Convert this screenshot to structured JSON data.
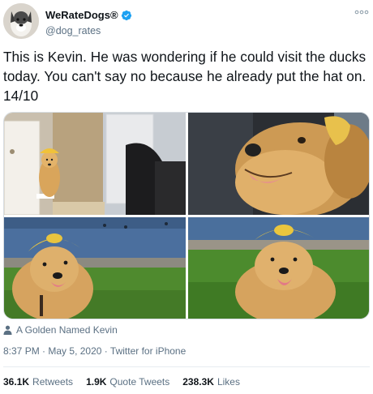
{
  "author": {
    "display_name": "WeRateDogs®",
    "handle": "@dog_rates"
  },
  "tweet": {
    "text": "This is Kevin. He was wondering if he could visit the ducks today. You can't say no because he already put the hat on. 14/10",
    "tagged_user": "A Golden Named Kevin",
    "time": "8:37 PM",
    "separator": "·",
    "date": "May 5, 2020",
    "source": "Twitter for iPhone"
  },
  "stats": {
    "retweets_count": "36.1K",
    "retweets_label": "Retweets",
    "quote_count": "1.9K",
    "quote_label": "Quote Tweets",
    "likes_count": "238.3K",
    "likes_label": "Likes"
  },
  "icons": {
    "verified": "verified-badge-icon",
    "more": "more-options-icon",
    "tag": "person-icon"
  },
  "colors": {
    "verified_blue": "#1da1f2",
    "secondary_text": "#5b7083",
    "primary_text": "#0f1419"
  }
}
